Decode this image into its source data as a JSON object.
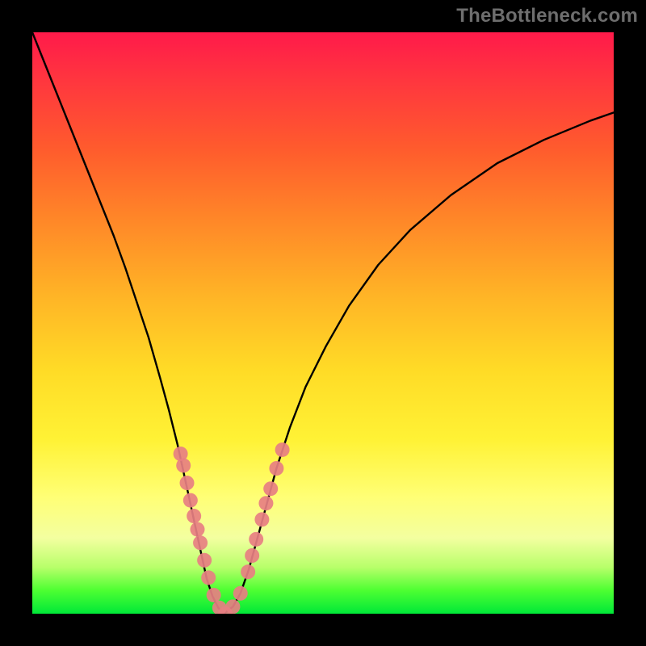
{
  "watermark": "TheBottleneck.com",
  "chart_data": {
    "type": "line",
    "title": "",
    "xlabel": "",
    "ylabel": "",
    "xlim": [
      0,
      1
    ],
    "ylim": [
      0,
      1
    ],
    "curve1": {
      "name": "left-branch",
      "points": [
        [
          0.0,
          1.0
        ],
        [
          0.02,
          0.95
        ],
        [
          0.04,
          0.9
        ],
        [
          0.06,
          0.85
        ],
        [
          0.08,
          0.8
        ],
        [
          0.1,
          0.75
        ],
        [
          0.12,
          0.7
        ],
        [
          0.14,
          0.65
        ],
        [
          0.16,
          0.595
        ],
        [
          0.18,
          0.535
        ],
        [
          0.2,
          0.475
        ],
        [
          0.21,
          0.44
        ],
        [
          0.22,
          0.405
        ],
        [
          0.235,
          0.35
        ],
        [
          0.25,
          0.29
        ],
        [
          0.262,
          0.235
        ],
        [
          0.275,
          0.175
        ],
        [
          0.288,
          0.115
        ],
        [
          0.3,
          0.06
        ],
        [
          0.31,
          0.03
        ],
        [
          0.32,
          0.01
        ],
        [
          0.33,
          0.0
        ]
      ]
    },
    "curve2": {
      "name": "right-branch",
      "points": [
        [
          0.33,
          0.0
        ],
        [
          0.345,
          0.012
        ],
        [
          0.358,
          0.035
        ],
        [
          0.372,
          0.075
        ],
        [
          0.39,
          0.14
        ],
        [
          0.405,
          0.195
        ],
        [
          0.42,
          0.25
        ],
        [
          0.443,
          0.32
        ],
        [
          0.47,
          0.39
        ],
        [
          0.505,
          0.46
        ],
        [
          0.545,
          0.53
        ],
        [
          0.595,
          0.6
        ],
        [
          0.65,
          0.66
        ],
        [
          0.72,
          0.72
        ],
        [
          0.8,
          0.775
        ],
        [
          0.88,
          0.815
        ],
        [
          0.96,
          0.848
        ],
        [
          1.0,
          0.862
        ]
      ]
    },
    "markers": {
      "name": "highlight-dots",
      "color": "#e77f82",
      "radius_px": 9,
      "points": [
        [
          0.255,
          0.275
        ],
        [
          0.26,
          0.255
        ],
        [
          0.266,
          0.225
        ],
        [
          0.272,
          0.195
        ],
        [
          0.278,
          0.168
        ],
        [
          0.284,
          0.145
        ],
        [
          0.289,
          0.122
        ],
        [
          0.296,
          0.092
        ],
        [
          0.303,
          0.062
        ],
        [
          0.312,
          0.032
        ],
        [
          0.322,
          0.01
        ],
        [
          0.332,
          0.0
        ],
        [
          0.345,
          0.012
        ],
        [
          0.358,
          0.035
        ],
        [
          0.371,
          0.072
        ],
        [
          0.378,
          0.1
        ],
        [
          0.385,
          0.128
        ],
        [
          0.395,
          0.162
        ],
        [
          0.402,
          0.19
        ],
        [
          0.41,
          0.215
        ],
        [
          0.42,
          0.25
        ],
        [
          0.43,
          0.282
        ]
      ]
    },
    "gradient_stops": {
      "top": "#ff1a4a",
      "mid": "#ffd726",
      "bottom": "#00e838"
    }
  }
}
